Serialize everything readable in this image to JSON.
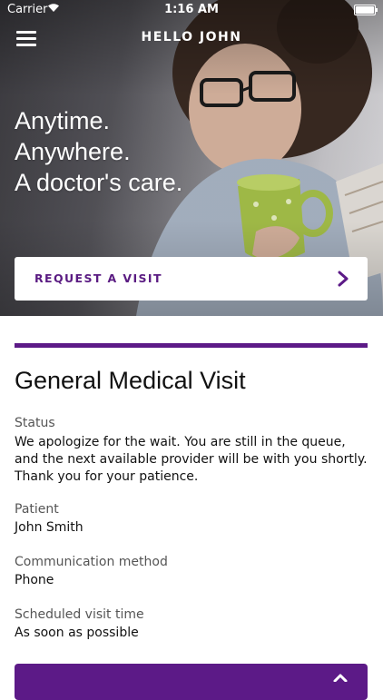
{
  "status_bar": {
    "carrier": "Carrier",
    "time": "1:16 AM",
    "wifi_icon": "wifi-icon",
    "battery_icon": "battery-icon"
  },
  "nav": {
    "title": "HELLO JOHN",
    "menu_icon": "hamburger-menu-icon"
  },
  "hero": {
    "tagline_line1": "Anytime.",
    "tagline_line2": "Anywhere.",
    "tagline_line3": "A doctor's care."
  },
  "request_visit": {
    "label": "REQUEST A VISIT",
    "icon": "chevron-right-icon"
  },
  "visit": {
    "title": "General Medical Visit",
    "status_label": "Status",
    "status_value": "We apologize for the wait. You are still in the queue, and the next available provider will be with you shortly. Thank you for your patience.",
    "patient_label": "Patient",
    "patient_value": "John Smith",
    "method_label": "Communication method",
    "method_value": "Phone",
    "time_label": "Scheduled visit time",
    "time_value": "As soon as possible"
  },
  "colors": {
    "accent": "#5c1a87",
    "white": "#ffffff"
  }
}
